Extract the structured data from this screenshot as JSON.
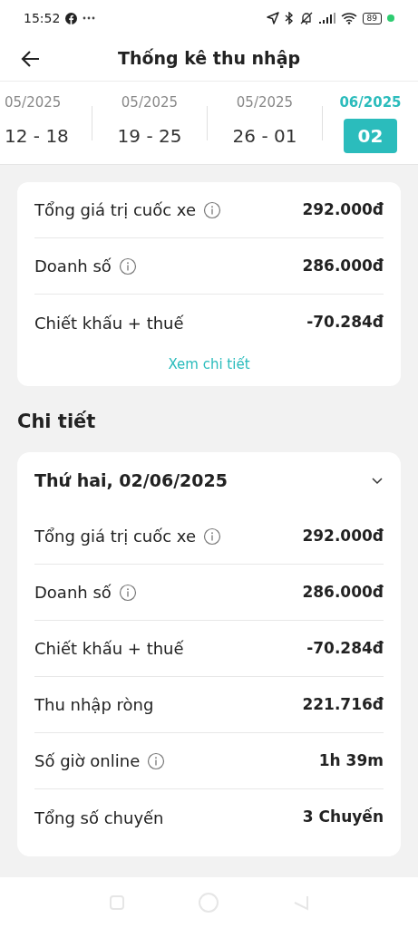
{
  "status_bar": {
    "time": "15:52",
    "battery": "89"
  },
  "header": {
    "title": "Thống kê thu nhập"
  },
  "weeks": [
    {
      "month": "05/2025",
      "range": "12 - 18",
      "selected": false
    },
    {
      "month": "05/2025",
      "range": "19 - 25",
      "selected": false
    },
    {
      "month": "05/2025",
      "range": "26 - 01",
      "selected": false
    },
    {
      "month": "06/2025",
      "range": "02",
      "selected": true
    }
  ],
  "summary": {
    "rows": [
      {
        "label": "Tổng giá trị cuốc xe",
        "info": true,
        "value": "292.000đ"
      },
      {
        "label": "Doanh số",
        "info": true,
        "value": "286.000đ"
      },
      {
        "label": "Chiết khấu + thuế",
        "info": false,
        "value": "-70.284đ"
      }
    ],
    "link": "Xem chi tiết"
  },
  "details": {
    "heading": "Chi tiết",
    "day": {
      "title": "Thứ hai, 02/06/2025",
      "expanded": true,
      "rows": [
        {
          "label": "Tổng giá trị cuốc xe",
          "info": true,
          "value": "292.000đ"
        },
        {
          "label": "Doanh số",
          "info": true,
          "value": "286.000đ"
        },
        {
          "label": "Chiết khấu + thuế",
          "info": false,
          "value": "-70.284đ"
        },
        {
          "label": "Thu nhập ròng",
          "info": false,
          "value": "221.716đ"
        },
        {
          "label": "Số giờ online",
          "info": true,
          "value": "1h 39m"
        },
        {
          "label": "Tổng số chuyến",
          "info": false,
          "value": "3 Chuyến"
        }
      ]
    }
  }
}
